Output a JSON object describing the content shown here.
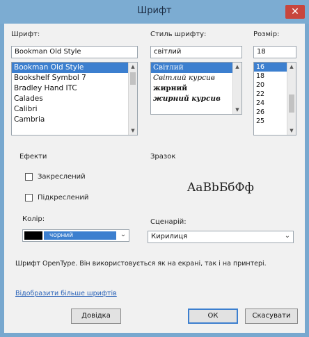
{
  "window": {
    "title": "Шрифт",
    "close_glyph": "✕"
  },
  "font": {
    "label": "Шрифт:",
    "value": "Bookman Old Style",
    "items": [
      {
        "label": "Bookman Old Style",
        "selected": true
      },
      {
        "label": "Bookshelf Symbol 7",
        "selected": false
      },
      {
        "label": "Bradley Hand ITC",
        "selected": false
      },
      {
        "label": "Calades",
        "selected": false
      },
      {
        "label": "Calibri",
        "selected": false
      },
      {
        "label": "Cambria",
        "selected": false
      }
    ]
  },
  "style": {
    "label": "Стиль шрифту:",
    "value": "світлий",
    "items": [
      {
        "label": "Світлий",
        "selected": true
      },
      {
        "label": "Світлий курсив",
        "selected": false
      },
      {
        "label": "жирний",
        "selected": false
      },
      {
        "label": "жирний курсив",
        "selected": false
      }
    ]
  },
  "size": {
    "label": "Розмір:",
    "value": "18",
    "items": [
      {
        "label": "16",
        "selected": true
      },
      {
        "label": "18",
        "selected": false
      },
      {
        "label": "20",
        "selected": false
      },
      {
        "label": "22",
        "selected": false
      },
      {
        "label": "24",
        "selected": false
      },
      {
        "label": "26",
        "selected": false
      },
      {
        "label": "25",
        "selected": false
      }
    ]
  },
  "effects": {
    "label": "Ефекти",
    "strikethrough": "Закреслений",
    "underline": "Підкреслений"
  },
  "color": {
    "label": "Колір:",
    "value": "чорний",
    "swatch": "#000000",
    "selection": "#3c7fcf"
  },
  "sample": {
    "label": "Зразок",
    "text": "AaBbБбФф"
  },
  "script": {
    "label": "Сценарій:",
    "value": "Кирилиця"
  },
  "info": "Шрифт OpenType. Він використовується як на екрані, так і на принтері.",
  "more_fonts_link": "Відобразити більше шрифтів",
  "buttons": {
    "help": "Довідка",
    "ok": "ОК",
    "cancel": "Скасувати"
  },
  "icons": {
    "scroll_up": "▲",
    "scroll_down": "▼",
    "combo_arrow": "⌄"
  }
}
